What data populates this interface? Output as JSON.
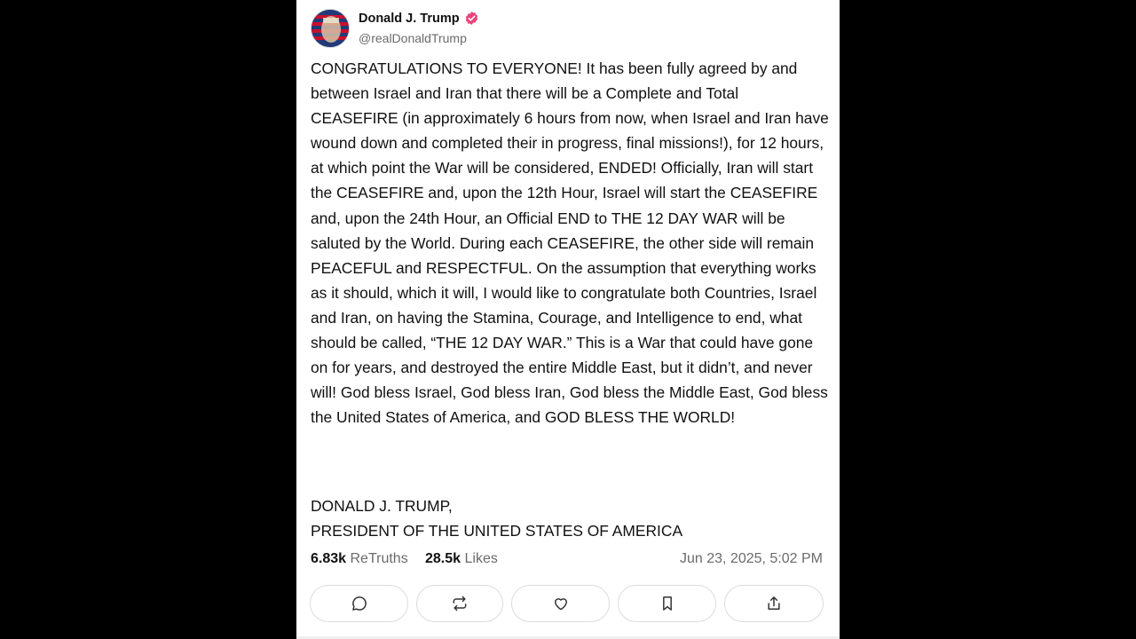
{
  "user": {
    "display_name": "Donald J. Trump",
    "handle": "@realDonaldTrump",
    "verified": true,
    "verified_color": "#e9457a"
  },
  "post": {
    "body": "CONGRATULATIONS TO EVERYONE! It has been fully agreed by and between Israel and Iran that there will be a Complete and Total CEASEFIRE (in approximately 6 hours from now, when Israel and Iran have wound down and completed their in progress, final missions!), for 12 hours, at which point the War will be considered, ENDED! Officially, Iran will start the CEASEFIRE and, upon the 12th Hour, Israel will start the CEASEFIRE and, upon the 24th Hour, an Official END to THE 12 DAY WAR will be saluted by the World. During each CEASEFIRE, the other side will remain PEACEFUL and RESPECTFUL. On the assumption that everything works as it should, which it will, I would like to congratulate both Countries, Israel and Iran, on having the Stamina, Courage, and Intelligence to end, what should be called, “THE 12 DAY WAR.” This is a War that could have gone on for years, and destroyed the entire Middle East, but it didn’t, and never will! God bless Israel, God bless Iran, God bless the Middle East, God bless the United States of America, and GOD BLESS THE WORLD!",
    "signature_line1": "DONALD J. TRUMP,",
    "signature_line2": "PRESIDENT OF THE UNITED STATES OF AMERICA"
  },
  "stats": {
    "retruths_count": "6.83k",
    "retruths_label": "ReTruths",
    "likes_count": "28.5k",
    "likes_label": "Likes",
    "timestamp": "Jun 23, 2025, 5:02 PM"
  },
  "actions": [
    {
      "icon": "comment-icon"
    },
    {
      "icon": "retruth-icon"
    },
    {
      "icon": "heart-icon"
    },
    {
      "icon": "bookmark-icon"
    },
    {
      "icon": "share-icon"
    }
  ]
}
